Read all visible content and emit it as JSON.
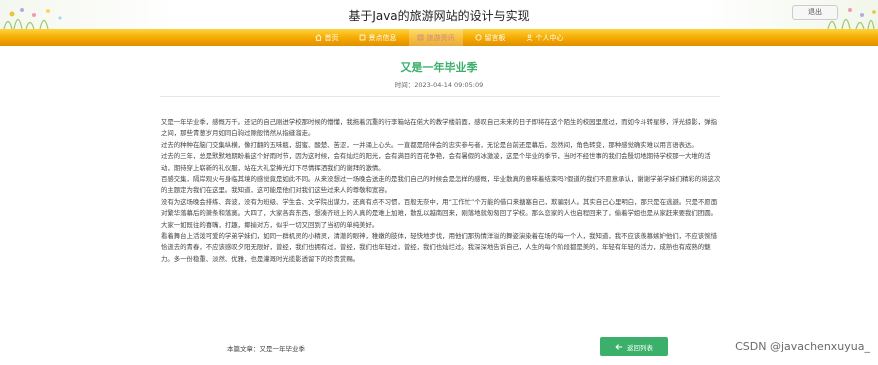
{
  "header": {
    "site_title": "基于Java的旅游网站的设计与实现",
    "logout_label": "退出"
  },
  "nav": {
    "items": [
      {
        "label": "首页",
        "icon": "home-icon"
      },
      {
        "label": "景点信息",
        "icon": "location-icon"
      },
      {
        "label": "旅游资讯",
        "icon": "news-icon",
        "active": true
      },
      {
        "label": "留言板",
        "icon": "message-icon"
      },
      {
        "label": "个人中心",
        "icon": "user-icon"
      }
    ]
  },
  "article": {
    "title": "又是一年毕业季",
    "time": "时间：2023-04-14 09:05:09",
    "paragraphs": [
      "又是一年毕业季，感慨万千。还记的自己刚进学校那时候的懵懂，我拖着沉重的行李箱站在偌大的教学楼前面，感叹自己未来的日子即将在这个陌生的校园里度过，而如今斗转星移，浮光掠影，弹指之间，那些青葱岁月如同白驹过隙般悄然从指缝溜走。",
      "过去的种种在脑门交集纵横，像打翻的五味瓶，甜蜜、酸楚、苦涩，一并涌上心头。一直都是陪伴会的忠实参与者，无论是台前还是幕后，忽然间，角色转变，那种感觉确实难以用言语表达。",
      "过去的三年，总是默默地期盼着这个好雨时节，因为这时候，会有灿烂的阳光，会有满目的百花争艳，会有暑假的冰激凌，这是个毕业的季节，当时不经世事的我们会殷切地期待学校那一大堆的活动，期待穿上崭新的礼仪服，站在大礼堂捧光灯下尽情挥洒我们的谢拜的激情。",
      "百感交集，隔岸观火与身临其境的感觉竟是如此不同。从来没想过一场晚会送走的是我们自己的时候会是怎样的感慨，毕业散真的意味着结束吗?假道的我们不愿意承认，谢谢学弟学妹们精彩的将这次的主题定为我们在这里。我知道，这可能是他们对我们这些过来人的尊敬和宽容。",
      "没有为这场晚会排练、奔波，没有为班级、学生会、文学院出谋力，还真有点不习惯，百般无奈中，用“工作忙”个万能的借口来搪塞自己，欺骗别人。其实自己心里明白，那只是在逃避。只是不愿面对繁华落幕后的萧条和落寞。大四了，大家各奔东西，想凑齐班上的人真的是难上加难，散乱以越南回来，刚落地就匆匆回了学校。那么恋家的人也启程回来了，偷着学姐也是从家赶来要我们团圆。大家一如既往的喜嘴，打趣，揶揄对方，似乎一切又回到了当初的单纯美好。",
      "看着舞台上活泼可爱的学弟学妹们，如同一群机灵的小精灵，清澈的眼神，稚嫩的肢体，轻快地步伐，用他们那热情洋溢的舞姿演染着在场的每一个人，我知道，我不应该羡慕嫉妒他们，不应该惋惜恰逝去的青春，不应该感叹夕阳无限好，曾经，我们也拥有过，曾经，我们也年轻过，曾经，我们也灿烂过。我深深地告诉自己，人生的每个阶段都是美的，年轻有年轻的活力，成熟也有成熟的魅力。多一份稳重、淡然、优雅，也是灌溉时光揽影透留下的珍贵赏赐。"
    ]
  },
  "footer": {
    "this_article_label": "本篇文章：又是一年毕业季",
    "back_label": "返回列表"
  },
  "watermark": "CSDN @javachenxuyua_",
  "colors": {
    "accent_green": "#3bb06a",
    "nav_orange": "#f5a800",
    "nav_active_text": "#c98a8a"
  }
}
